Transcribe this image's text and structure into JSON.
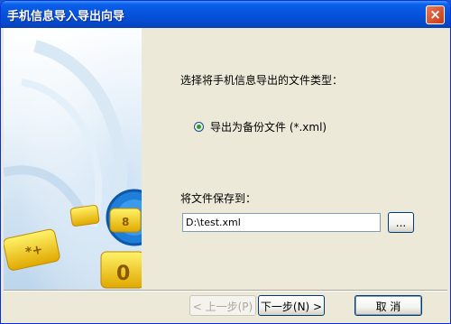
{
  "window": {
    "title": "手机信息导入导出向导",
    "close_label": "×"
  },
  "content": {
    "prompt": "选择将手机信息导出的文件类型：",
    "radio_option": "导出为备份文件 (*.xml)",
    "save_label": "将文件保存到：",
    "path_value": "D:\\test.xml",
    "browse_label": "..."
  },
  "buttons": {
    "back": "< 上一步(P)",
    "next": "下一步(N) >",
    "cancel": "取 消"
  },
  "artwork": {
    "key_labels": [
      "*+",
      "8",
      "0"
    ]
  },
  "colors": {
    "titlebar": "#0552dc",
    "dialog_bg": "#ece9d8",
    "radio_dot": "#21a121"
  }
}
